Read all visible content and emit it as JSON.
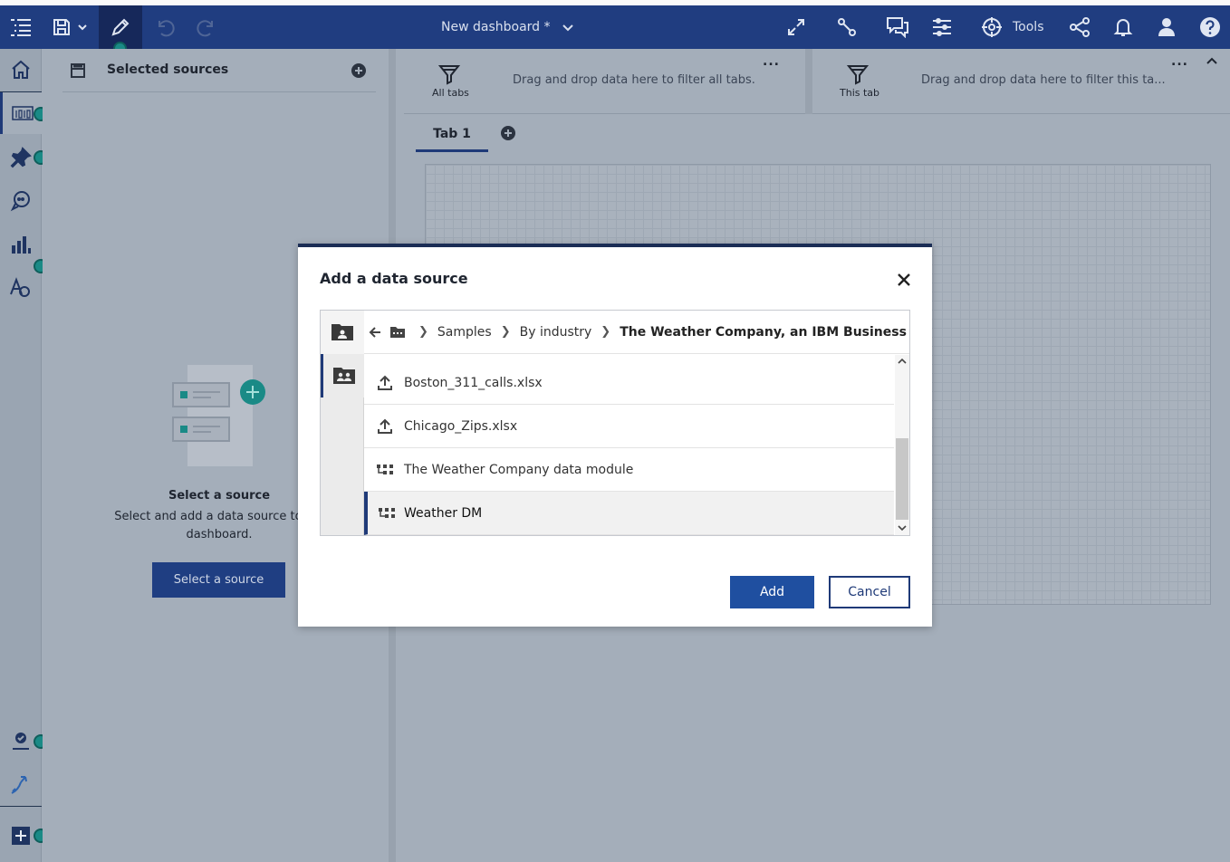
{
  "toolbar": {
    "dashboard_title": "New dashboard *",
    "tools_label": "Tools"
  },
  "sources_panel": {
    "title": "Selected sources",
    "empty_title": "Select a source",
    "empty_desc": "Select and add a data source to bui dashboard.",
    "select_button": "Select a source"
  },
  "filters": {
    "all_tabs_label": "All tabs",
    "all_tabs_hint": "Drag and drop data here to filter all tabs.",
    "this_tab_label": "This tab",
    "this_tab_hint": "Drag and drop data here to filter this ta...",
    "more": "..."
  },
  "tabs": [
    {
      "label": "Tab 1"
    }
  ],
  "modal": {
    "title": "Add a data source",
    "breadcrumbs": [
      "Samples",
      "By industry",
      "The Weather Company, an IBM Business"
    ],
    "items": [
      {
        "name": "Boston_311_calls.xlsx",
        "icon": "upload-icon"
      },
      {
        "name": "Chicago_Zips.xlsx",
        "icon": "upload-icon"
      },
      {
        "name": "The Weather Company data module",
        "icon": "data-module-icon"
      },
      {
        "name": "Weather DM",
        "icon": "data-module-icon",
        "selected": true
      }
    ],
    "add_button": "Add",
    "cancel_button": "Cancel"
  },
  "colors": {
    "toolbar": "#203d80",
    "accent": "#1f3a78",
    "primary_button": "#1f4fa0",
    "status_dot": "#1a8a86"
  }
}
